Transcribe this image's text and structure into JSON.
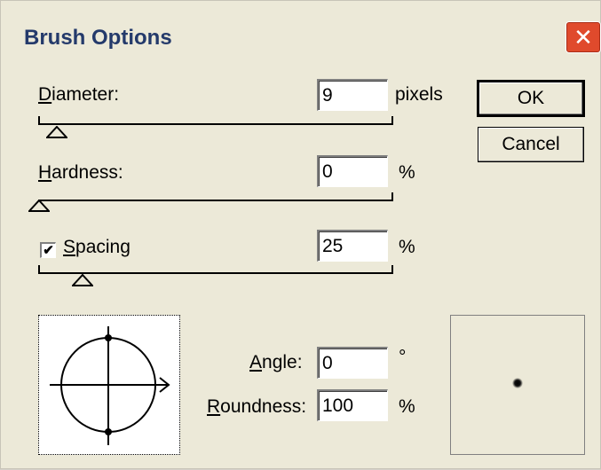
{
  "dialog": {
    "title": "Brush Options",
    "close_glyph": "✕"
  },
  "diameter": {
    "label_u": "D",
    "label_rest": "iameter:",
    "value": "9",
    "unit": "pixels",
    "slider_level": 0.1
  },
  "hardness": {
    "label_u": "H",
    "label_rest": "ardness:",
    "value": "0",
    "unit": "%",
    "slider_level": 0.0
  },
  "spacing": {
    "checked": true,
    "check_glyph": "✔",
    "label_u": "S",
    "label_rest": "pacing",
    "value": "25",
    "unit": "%",
    "slider_level": 0.15
  },
  "angle": {
    "label_u": "A",
    "label_rest": "ngle:",
    "value": "0",
    "unit": "°"
  },
  "roundness": {
    "label_u": "R",
    "label_rest": "oundness:",
    "value": "100",
    "unit": "%"
  },
  "buttons": {
    "ok": "OK",
    "cancel": "Cancel"
  },
  "icons": {
    "close": "close-icon",
    "brush_shape": "brush-shape-editor-icon",
    "brush_tip": "brush-tip-preview-icon"
  },
  "colors": {
    "title": "#243a6b",
    "close": "#e04a2c",
    "background": "#ece9d8"
  }
}
